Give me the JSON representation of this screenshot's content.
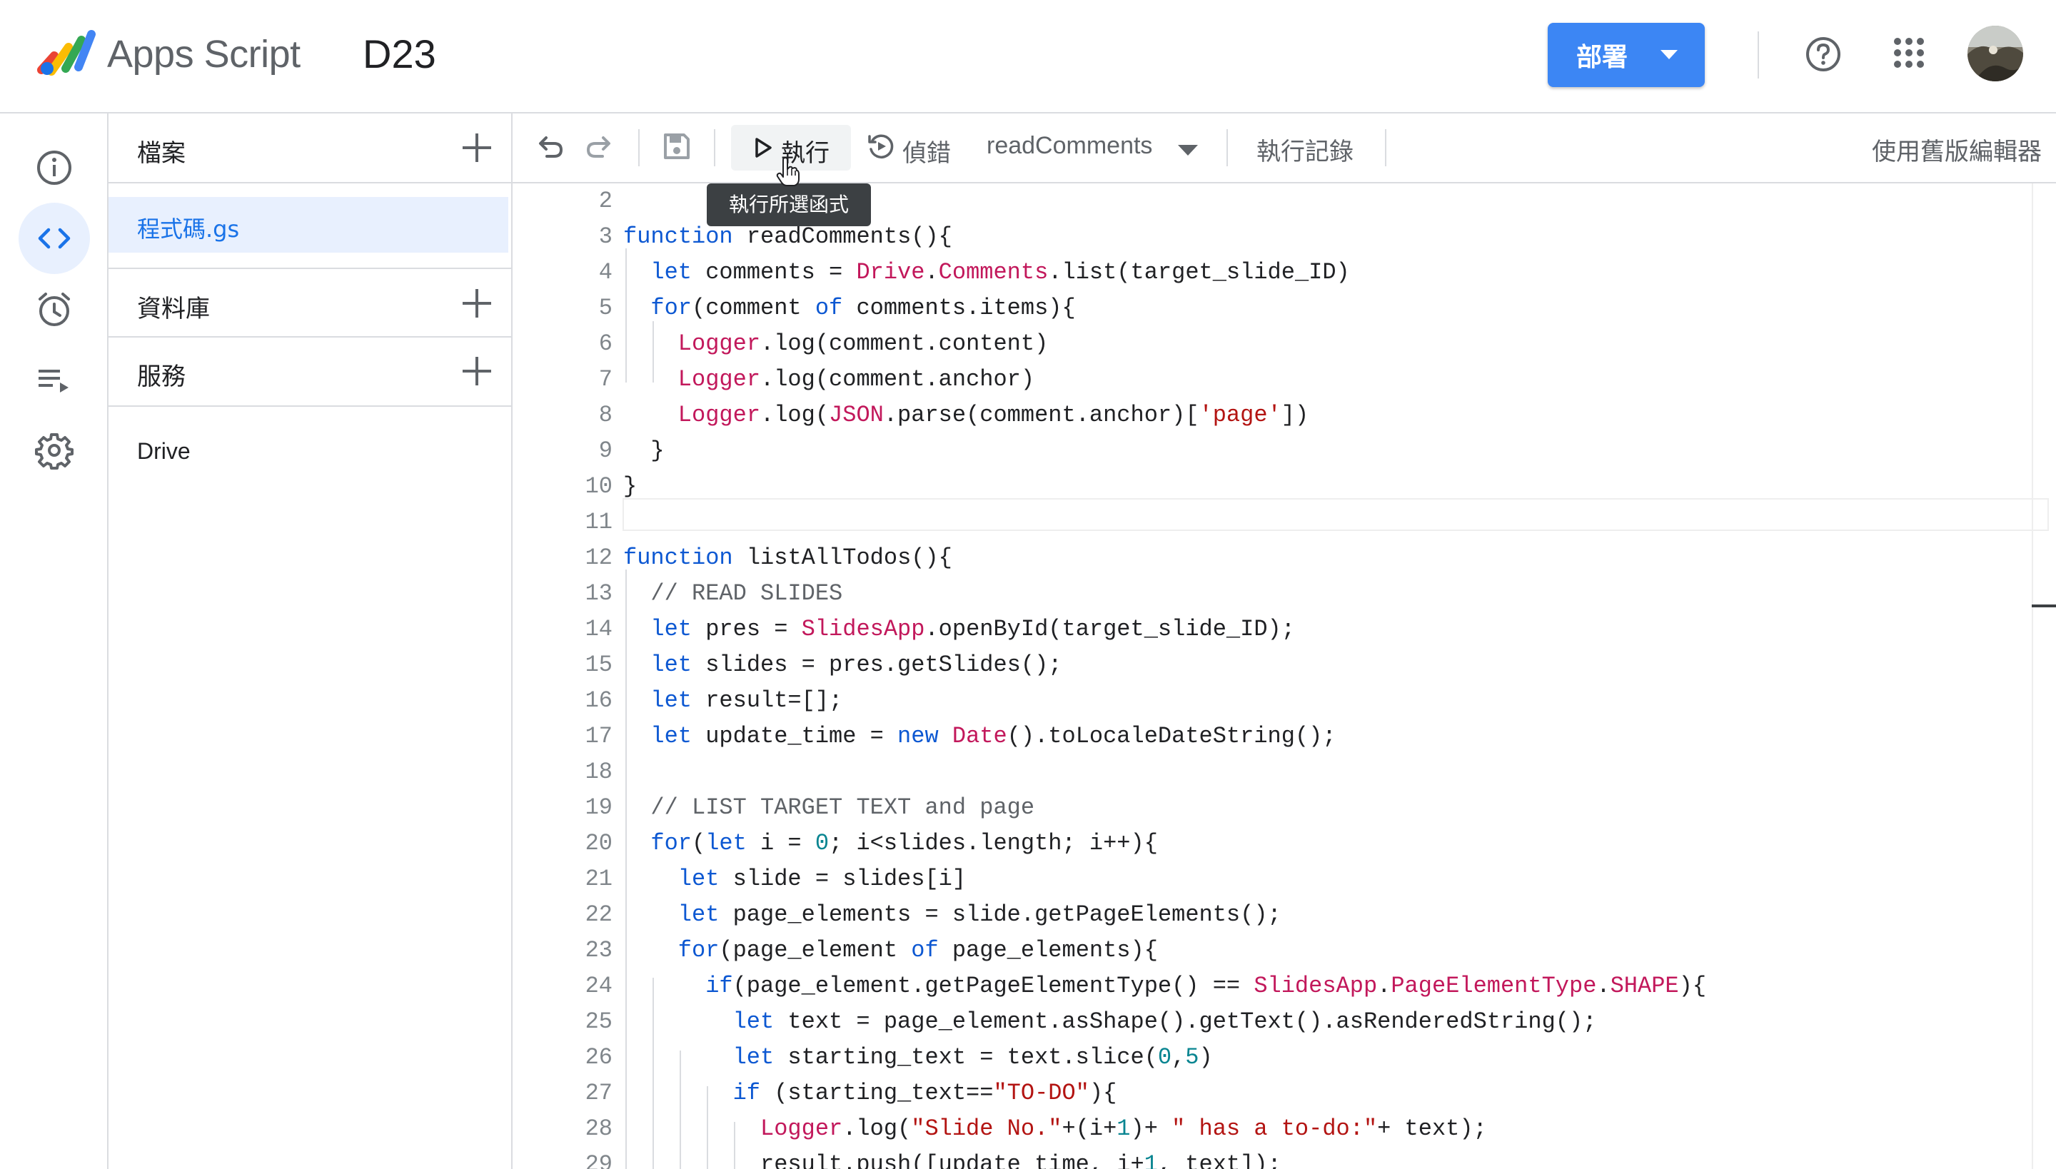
{
  "header": {
    "app_name": "Apps Script",
    "project_name": "D23",
    "deploy_label": "部署",
    "icons": [
      "apps-script-logo",
      "help-icon",
      "apps-grid-icon",
      "avatar"
    ]
  },
  "rail": {
    "items": [
      {
        "name": "overview",
        "icon": "info-icon"
      },
      {
        "name": "editor",
        "icon": "code-icon",
        "active": true
      },
      {
        "name": "triggers",
        "icon": "alarm-icon"
      },
      {
        "name": "executions",
        "icon": "playlist-icon"
      },
      {
        "name": "settings",
        "icon": "gear-icon"
      }
    ]
  },
  "files_panel": {
    "files_title": "檔案",
    "file_name": "程式碼.gs",
    "libraries_title": "資料庫",
    "services_title": "服務",
    "service_name": "Drive"
  },
  "toolbar": {
    "run_label": "執行",
    "debug_label": "偵錯",
    "function_name": "readComments",
    "log_label": "執行記錄",
    "legacy_label": "使用舊版編輯器",
    "tooltip": "執行所選函式"
  },
  "colors": {
    "accent": "#1a73e8",
    "deploy_button": "#3c86f4",
    "keyword": "#0d58d2",
    "class": "#c2185b",
    "string": "#b31412",
    "number": "#098591"
  },
  "editor": {
    "lines": [
      {
        "n": "2",
        "indent": 0,
        "tokens": []
      },
      {
        "n": "3",
        "indent": 0,
        "tokens": [
          [
            "kw",
            "function"
          ],
          [
            "p",
            " readComments(){"
          ]
        ]
      },
      {
        "n": "4",
        "indent": 1,
        "tokens": [
          [
            "kw",
            "let"
          ],
          [
            "p",
            " comments = "
          ],
          [
            "cls",
            "Drive"
          ],
          [
            "p",
            "."
          ],
          [
            "cls",
            "Comments"
          ],
          [
            "p",
            ".list(target_slide_ID)"
          ]
        ]
      },
      {
        "n": "5",
        "indent": 1,
        "tokens": [
          [
            "kw",
            "for"
          ],
          [
            "p",
            "(comment "
          ],
          [
            "kw",
            "of"
          ],
          [
            "p",
            " comments.items){"
          ]
        ]
      },
      {
        "n": "6",
        "indent": 2,
        "tokens": [
          [
            "cls",
            "Logger"
          ],
          [
            "p",
            ".log(comment.content)"
          ]
        ]
      },
      {
        "n": "7",
        "indent": 2,
        "tokens": [
          [
            "cls",
            "Logger"
          ],
          [
            "p",
            ".log(comment.anchor)"
          ]
        ]
      },
      {
        "n": "8",
        "indent": 2,
        "tokens": [
          [
            "cls",
            "Logger"
          ],
          [
            "p",
            ".log("
          ],
          [
            "cls",
            "JSON"
          ],
          [
            "p",
            ".parse(comment.anchor)["
          ],
          [
            "str",
            "'page'"
          ],
          [
            "p",
            "])"
          ]
        ]
      },
      {
        "n": "9",
        "indent": 1,
        "tokens": [
          [
            "p",
            "}"
          ]
        ]
      },
      {
        "n": "10",
        "indent": 0,
        "tokens": [
          [
            "p",
            "}"
          ]
        ]
      },
      {
        "n": "11",
        "indent": 0,
        "tokens": []
      },
      {
        "n": "12",
        "indent": 0,
        "tokens": [
          [
            "kw",
            "function"
          ],
          [
            "p",
            " listAllTodos(){"
          ]
        ]
      },
      {
        "n": "13",
        "indent": 1,
        "tokens": [
          [
            "cm",
            "// READ SLIDES"
          ]
        ]
      },
      {
        "n": "14",
        "indent": 1,
        "tokens": [
          [
            "kw",
            "let"
          ],
          [
            "p",
            " pres = "
          ],
          [
            "cls",
            "SlidesApp"
          ],
          [
            "p",
            ".openById(target_slide_ID);"
          ]
        ]
      },
      {
        "n": "15",
        "indent": 1,
        "tokens": [
          [
            "kw",
            "let"
          ],
          [
            "p",
            " slides = pres.getSlides();"
          ]
        ]
      },
      {
        "n": "16",
        "indent": 1,
        "tokens": [
          [
            "kw",
            "let"
          ],
          [
            "p",
            " result=[];"
          ]
        ]
      },
      {
        "n": "17",
        "indent": 1,
        "tokens": [
          [
            "kw",
            "let"
          ],
          [
            "p",
            " update_time = "
          ],
          [
            "kw",
            "new"
          ],
          [
            "p",
            " "
          ],
          [
            "cls",
            "Date"
          ],
          [
            "p",
            "().toLocaleDateString();"
          ]
        ]
      },
      {
        "n": "18",
        "indent": 0,
        "tokens": []
      },
      {
        "n": "19",
        "indent": 1,
        "tokens": [
          [
            "cm",
            "// LIST TARGET TEXT and page"
          ]
        ]
      },
      {
        "n": "20",
        "indent": 1,
        "tokens": [
          [
            "kw",
            "for"
          ],
          [
            "p",
            "("
          ],
          [
            "kw",
            "let"
          ],
          [
            "p",
            " i = "
          ],
          [
            "num",
            "0"
          ],
          [
            "p",
            "; i<slides.length; i++){"
          ]
        ]
      },
      {
        "n": "21",
        "indent": 2,
        "tokens": [
          [
            "kw",
            "let"
          ],
          [
            "p",
            " slide = slides[i]"
          ]
        ]
      },
      {
        "n": "22",
        "indent": 2,
        "tokens": [
          [
            "kw",
            "let"
          ],
          [
            "p",
            " page_elements = slide.getPageElements();"
          ]
        ]
      },
      {
        "n": "23",
        "indent": 2,
        "tokens": [
          [
            "kw",
            "for"
          ],
          [
            "p",
            "(page_element "
          ],
          [
            "kw",
            "of"
          ],
          [
            "p",
            " page_elements){"
          ]
        ]
      },
      {
        "n": "24",
        "indent": 3,
        "tokens": [
          [
            "kw",
            "if"
          ],
          [
            "p",
            "(page_element.getPageElementType() == "
          ],
          [
            "cls",
            "SlidesApp"
          ],
          [
            "p",
            "."
          ],
          [
            "cls",
            "PageElementType"
          ],
          [
            "p",
            "."
          ],
          [
            "cls",
            "SHAPE"
          ],
          [
            "p",
            "){"
          ]
        ]
      },
      {
        "n": "25",
        "indent": 4,
        "tokens": [
          [
            "kw",
            "let"
          ],
          [
            "p",
            " text = page_element.asShape().getText().asRenderedString();"
          ]
        ]
      },
      {
        "n": "26",
        "indent": 4,
        "tokens": [
          [
            "kw",
            "let"
          ],
          [
            "p",
            " starting_text = text.slice("
          ],
          [
            "num",
            "0"
          ],
          [
            "p",
            ","
          ],
          [
            "num",
            "5"
          ],
          [
            "p",
            ")"
          ]
        ]
      },
      {
        "n": "27",
        "indent": 4,
        "tokens": [
          [
            "kw",
            "if"
          ],
          [
            "p",
            " (starting_text=="
          ],
          [
            "str",
            "\"TO-DO\""
          ],
          [
            "p",
            "){"
          ]
        ]
      },
      {
        "n": "28",
        "indent": 5,
        "tokens": [
          [
            "cls",
            "Logger"
          ],
          [
            "p",
            ".log("
          ],
          [
            "str",
            "\"Slide No.\""
          ],
          [
            "p",
            "+(i+"
          ],
          [
            "num",
            "1"
          ],
          [
            "p",
            ")+ "
          ],
          [
            "str",
            "\" has a to-do:\""
          ],
          [
            "p",
            "+ text);"
          ]
        ]
      },
      {
        "n": "29",
        "indent": 5,
        "tokens": [
          [
            "p",
            "result.push([update_time, i+"
          ],
          [
            "num",
            "1"
          ],
          [
            "p",
            ", text]);"
          ]
        ]
      }
    ]
  }
}
